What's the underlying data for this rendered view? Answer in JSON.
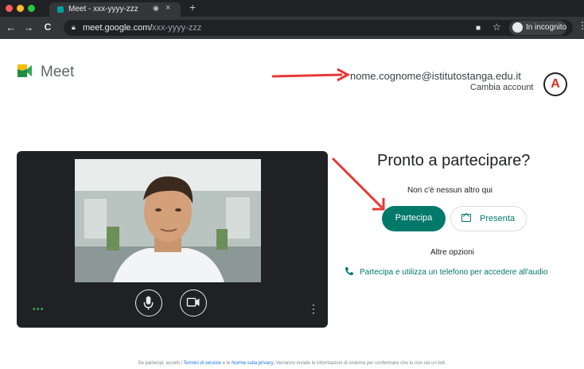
{
  "browser": {
    "tab_title": "Meet - xxx-yyyy-zzz",
    "tab_close": "×",
    "new_tab": "+",
    "url_host": "meet.google.com/",
    "url_path": "xxx-yyyy-zzz",
    "incognito_label": "In incognito",
    "back": "←",
    "forward": "→",
    "reload": "C"
  },
  "meet": {
    "brand": "Meet",
    "account_email": "nome.cognome@istitutostanga.edu.it",
    "switch_account": "Cambia account",
    "avatar_letter": "A"
  },
  "preview": {
    "more_dots": "•••",
    "menu_dots": "⋮"
  },
  "join": {
    "title": "Pronto a partecipare?",
    "nobody_here": "Non c'è nessun altro qui",
    "join_button": "Partecipa",
    "present_button": "Presenta",
    "other_options": "Altre opzioni",
    "phone_option": "Partecipa e utilizza un telefono per accedere all'audio"
  },
  "footer": {
    "prefix": "Se partecipi, accetti i ",
    "terms": "Termini di servizio",
    "and": " e le ",
    "privacy": "Norme sulla privacy",
    "suffix": ". Verranno inviate le informazioni di sistema per confermare che tu non sia un bot."
  },
  "colors": {
    "accent": "#00796b",
    "annotation_red": "#e53935"
  },
  "icons": [
    "lock-icon",
    "camera-blocked-icon",
    "star-icon",
    "incognito-icon",
    "meet-logo-icon",
    "microphone-icon",
    "video-camera-icon",
    "present-screen-icon",
    "phone-icon"
  ]
}
